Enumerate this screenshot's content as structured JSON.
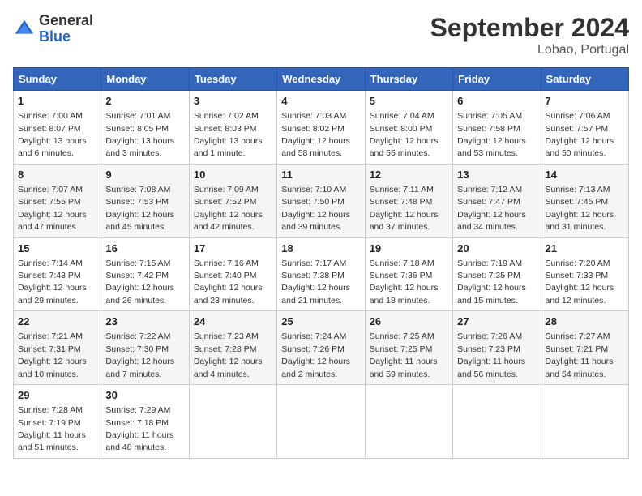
{
  "header": {
    "logo_general": "General",
    "logo_blue": "Blue",
    "month_title": "September 2024",
    "location": "Lobao, Portugal"
  },
  "weekdays": [
    "Sunday",
    "Monday",
    "Tuesday",
    "Wednesday",
    "Thursday",
    "Friday",
    "Saturday"
  ],
  "weeks": [
    [
      {
        "day": "1",
        "sunrise": "7:00 AM",
        "sunset": "8:07 PM",
        "daylight": "13 hours and 6 minutes."
      },
      {
        "day": "2",
        "sunrise": "7:01 AM",
        "sunset": "8:05 PM",
        "daylight": "13 hours and 3 minutes."
      },
      {
        "day": "3",
        "sunrise": "7:02 AM",
        "sunset": "8:03 PM",
        "daylight": "13 hours and 1 minute."
      },
      {
        "day": "4",
        "sunrise": "7:03 AM",
        "sunset": "8:02 PM",
        "daylight": "12 hours and 58 minutes."
      },
      {
        "day": "5",
        "sunrise": "7:04 AM",
        "sunset": "8:00 PM",
        "daylight": "12 hours and 55 minutes."
      },
      {
        "day": "6",
        "sunrise": "7:05 AM",
        "sunset": "7:58 PM",
        "daylight": "12 hours and 53 minutes."
      },
      {
        "day": "7",
        "sunrise": "7:06 AM",
        "sunset": "7:57 PM",
        "daylight": "12 hours and 50 minutes."
      }
    ],
    [
      {
        "day": "8",
        "sunrise": "7:07 AM",
        "sunset": "7:55 PM",
        "daylight": "12 hours and 47 minutes."
      },
      {
        "day": "9",
        "sunrise": "7:08 AM",
        "sunset": "7:53 PM",
        "daylight": "12 hours and 45 minutes."
      },
      {
        "day": "10",
        "sunrise": "7:09 AM",
        "sunset": "7:52 PM",
        "daylight": "12 hours and 42 minutes."
      },
      {
        "day": "11",
        "sunrise": "7:10 AM",
        "sunset": "7:50 PM",
        "daylight": "12 hours and 39 minutes."
      },
      {
        "day": "12",
        "sunrise": "7:11 AM",
        "sunset": "7:48 PM",
        "daylight": "12 hours and 37 minutes."
      },
      {
        "day": "13",
        "sunrise": "7:12 AM",
        "sunset": "7:47 PM",
        "daylight": "12 hours and 34 minutes."
      },
      {
        "day": "14",
        "sunrise": "7:13 AM",
        "sunset": "7:45 PM",
        "daylight": "12 hours and 31 minutes."
      }
    ],
    [
      {
        "day": "15",
        "sunrise": "7:14 AM",
        "sunset": "7:43 PM",
        "daylight": "12 hours and 29 minutes."
      },
      {
        "day": "16",
        "sunrise": "7:15 AM",
        "sunset": "7:42 PM",
        "daylight": "12 hours and 26 minutes."
      },
      {
        "day": "17",
        "sunrise": "7:16 AM",
        "sunset": "7:40 PM",
        "daylight": "12 hours and 23 minutes."
      },
      {
        "day": "18",
        "sunrise": "7:17 AM",
        "sunset": "7:38 PM",
        "daylight": "12 hours and 21 minutes."
      },
      {
        "day": "19",
        "sunrise": "7:18 AM",
        "sunset": "7:36 PM",
        "daylight": "12 hours and 18 minutes."
      },
      {
        "day": "20",
        "sunrise": "7:19 AM",
        "sunset": "7:35 PM",
        "daylight": "12 hours and 15 minutes."
      },
      {
        "day": "21",
        "sunrise": "7:20 AM",
        "sunset": "7:33 PM",
        "daylight": "12 hours and 12 minutes."
      }
    ],
    [
      {
        "day": "22",
        "sunrise": "7:21 AM",
        "sunset": "7:31 PM",
        "daylight": "12 hours and 10 minutes."
      },
      {
        "day": "23",
        "sunrise": "7:22 AM",
        "sunset": "7:30 PM",
        "daylight": "12 hours and 7 minutes."
      },
      {
        "day": "24",
        "sunrise": "7:23 AM",
        "sunset": "7:28 PM",
        "daylight": "12 hours and 4 minutes."
      },
      {
        "day": "25",
        "sunrise": "7:24 AM",
        "sunset": "7:26 PM",
        "daylight": "12 hours and 2 minutes."
      },
      {
        "day": "26",
        "sunrise": "7:25 AM",
        "sunset": "7:25 PM",
        "daylight": "11 hours and 59 minutes."
      },
      {
        "day": "27",
        "sunrise": "7:26 AM",
        "sunset": "7:23 PM",
        "daylight": "11 hours and 56 minutes."
      },
      {
        "day": "28",
        "sunrise": "7:27 AM",
        "sunset": "7:21 PM",
        "daylight": "11 hours and 54 minutes."
      }
    ],
    [
      {
        "day": "29",
        "sunrise": "7:28 AM",
        "sunset": "7:19 PM",
        "daylight": "11 hours and 51 minutes."
      },
      {
        "day": "30",
        "sunrise": "7:29 AM",
        "sunset": "7:18 PM",
        "daylight": "11 hours and 48 minutes."
      },
      null,
      null,
      null,
      null,
      null
    ]
  ]
}
